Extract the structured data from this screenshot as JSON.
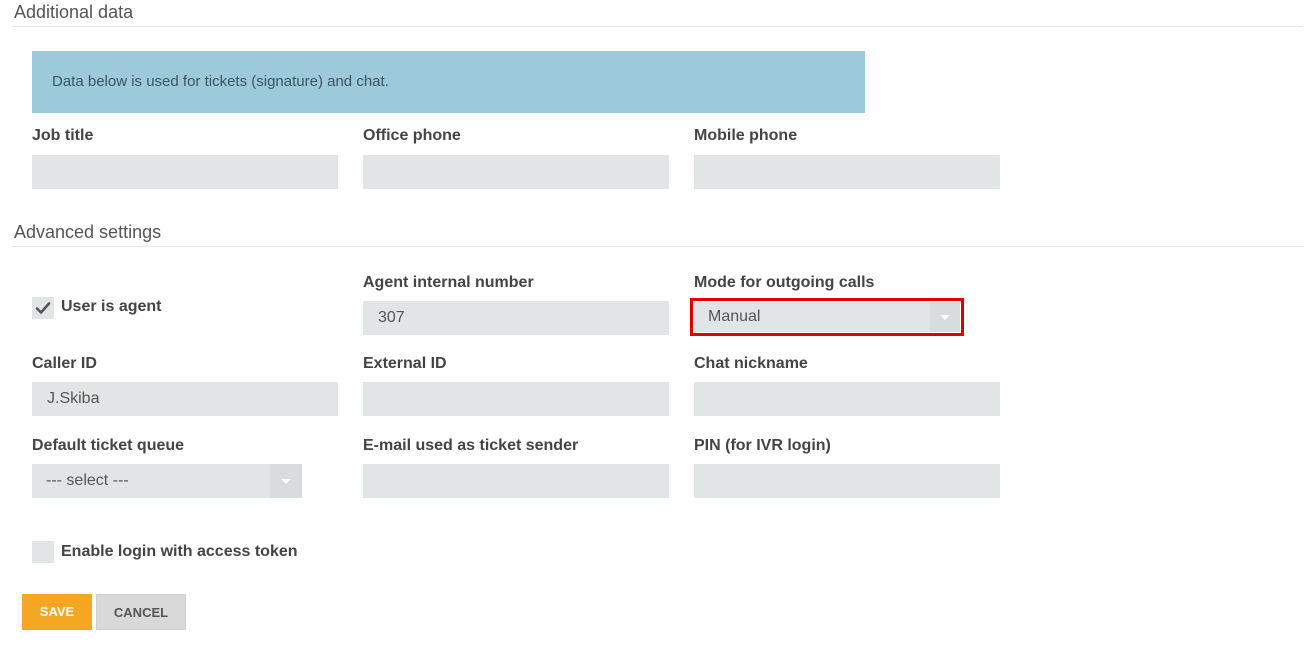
{
  "sections": {
    "additional_data_title": "Additional data",
    "advanced_settings_title": "Advanced settings"
  },
  "info_text": "Data below is used for tickets (signature) and chat.",
  "fields": {
    "job_title": {
      "label": "Job title",
      "value": ""
    },
    "office_phone": {
      "label": "Office phone",
      "value": ""
    },
    "mobile_phone": {
      "label": "Mobile phone",
      "value": ""
    },
    "agent_internal_number": {
      "label": "Agent internal number",
      "value": "307"
    },
    "mode_outgoing_calls": {
      "label": "Mode for outgoing calls",
      "value": "Manual"
    },
    "caller_id": {
      "label": "Caller ID",
      "value": "J.Skiba"
    },
    "external_id": {
      "label": "External ID",
      "value": ""
    },
    "chat_nickname": {
      "label": "Chat nickname",
      "value": ""
    },
    "default_ticket_queue": {
      "label": "Default ticket queue",
      "value": "--- select ---"
    },
    "email_ticket_sender": {
      "label": "E-mail used as ticket sender",
      "value": ""
    },
    "pin_ivr": {
      "label": "PIN (for IVR login)",
      "value": ""
    }
  },
  "checkboxes": {
    "user_is_agent": {
      "label": "User is agent",
      "checked": true
    },
    "enable_login_token": {
      "label": "Enable login with access token",
      "checked": false
    }
  },
  "buttons": {
    "save": "SAVE",
    "cancel": "CANCEL"
  },
  "colors": {
    "info_bg": "#9ccadb",
    "field_bg": "#e2e5e5",
    "save_bg": "#f5a623",
    "highlight": "#e00000"
  },
  "icons": {
    "check": "checkmark-icon",
    "dropdown": "chevron-down-icon"
  }
}
